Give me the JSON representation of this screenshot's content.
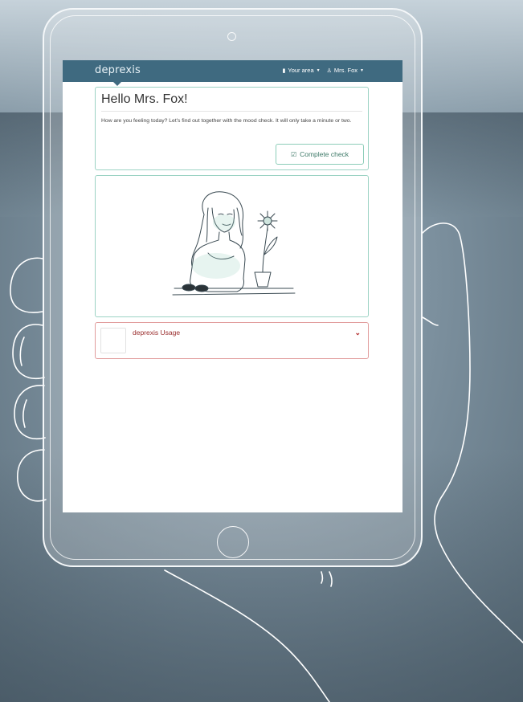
{
  "app": {
    "brand": "deprexis"
  },
  "navbar": {
    "your_area_label": "Your area",
    "user_label": "Mrs. Fox",
    "your_area_icon": "speech-bubble-icon",
    "user_icon": "user-icon"
  },
  "hello_card": {
    "title": "Hello Mrs. Fox!",
    "text": "How are you feeling today? Let's find out together with the mood check. It will only take a minute or two.",
    "button_label": "Complete check",
    "button_icon": "check-square-icon"
  },
  "usage_card": {
    "label": "deprexis Usage",
    "icon": "chevron-down-icon"
  },
  "colors": {
    "navbar": "#3f6a80",
    "card_border": "#9cd3c4",
    "usage_border": "#e19c9c",
    "usage_text": "#9a2d2d"
  }
}
